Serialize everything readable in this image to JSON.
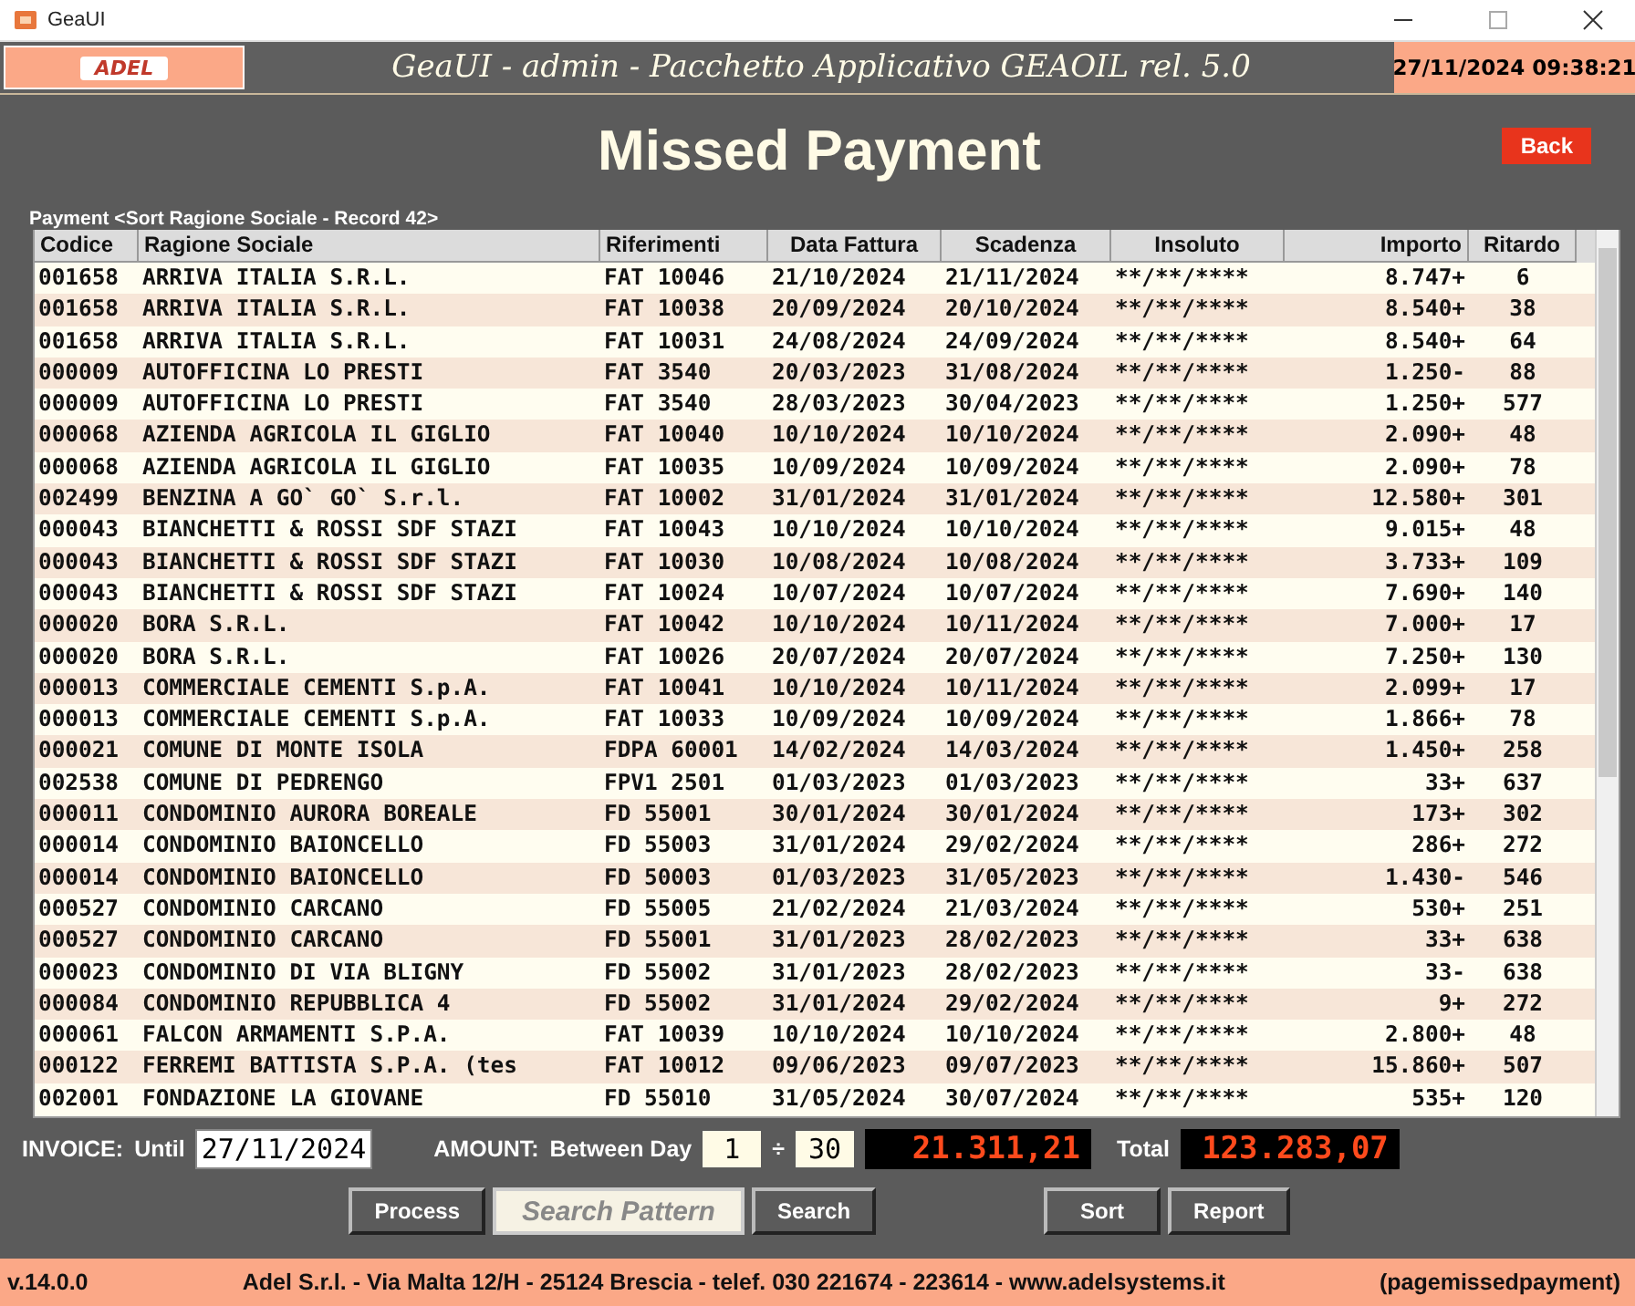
{
  "window": {
    "title": "GeaUI"
  },
  "header": {
    "logo": "ADEL",
    "title": "GeaUI - admin - Pacchetto Applicativo GEAOIL rel. 5.0",
    "datetime": "27/11/2024 09:38:21"
  },
  "page_title": "Missed Payment",
  "back_button": "Back",
  "table": {
    "caption": "Payment <Sort Ragione Sociale - Record 42>",
    "columns": [
      "Codice",
      "Ragione Sociale",
      "Riferimenti",
      "Data Fattura",
      "Scadenza",
      "Insoluto",
      "Importo",
      "Ritardo"
    ],
    "rows": [
      [
        "001658",
        "ARRIVA ITALIA S.R.L.",
        "FAT 10046",
        "21/10/2024",
        "21/11/2024",
        "**/**/****",
        "8.747+",
        "6"
      ],
      [
        "001658",
        "ARRIVA ITALIA S.R.L.",
        "FAT 10038",
        "20/09/2024",
        "20/10/2024",
        "**/**/****",
        "8.540+",
        "38"
      ],
      [
        "001658",
        "ARRIVA ITALIA S.R.L.",
        "FAT 10031",
        "24/08/2024",
        "24/09/2024",
        "**/**/****",
        "8.540+",
        "64"
      ],
      [
        "000009",
        "AUTOFFICINA LO PRESTI",
        "FAT 3540",
        "20/03/2023",
        "31/08/2024",
        "**/**/****",
        "1.250-",
        "88"
      ],
      [
        "000009",
        "AUTOFFICINA LO PRESTI",
        "FAT 3540",
        "28/03/2023",
        "30/04/2023",
        "**/**/****",
        "1.250+",
        "577"
      ],
      [
        "000068",
        "AZIENDA AGRICOLA IL GIGLIO",
        "FAT 10040",
        "10/10/2024",
        "10/10/2024",
        "**/**/****",
        "2.090+",
        "48"
      ],
      [
        "000068",
        "AZIENDA AGRICOLA IL GIGLIO",
        "FAT 10035",
        "10/09/2024",
        "10/09/2024",
        "**/**/****",
        "2.090+",
        "78"
      ],
      [
        "002499",
        "BENZINA A GO` GO` S.r.l.",
        "FAT 10002",
        "31/01/2024",
        "31/01/2024",
        "**/**/****",
        "12.580+",
        "301"
      ],
      [
        "000043",
        "BIANCHETTI & ROSSI SDF STAZI",
        "FAT 10043",
        "10/10/2024",
        "10/10/2024",
        "**/**/****",
        "9.015+",
        "48"
      ],
      [
        "000043",
        "BIANCHETTI & ROSSI SDF STAZI",
        "FAT 10030",
        "10/08/2024",
        "10/08/2024",
        "**/**/****",
        "3.733+",
        "109"
      ],
      [
        "000043",
        "BIANCHETTI & ROSSI SDF STAZI",
        "FAT 10024",
        "10/07/2024",
        "10/07/2024",
        "**/**/****",
        "7.690+",
        "140"
      ],
      [
        "000020",
        "BORA S.R.L.",
        "FAT 10042",
        "10/10/2024",
        "10/11/2024",
        "**/**/****",
        "7.000+",
        "17"
      ],
      [
        "000020",
        "BORA S.R.L.",
        "FAT 10026",
        "20/07/2024",
        "20/07/2024",
        "**/**/****",
        "7.250+",
        "130"
      ],
      [
        "000013",
        "COMMERCIALE CEMENTI S.p.A.",
        "FAT 10041",
        "10/10/2024",
        "10/11/2024",
        "**/**/****",
        "2.099+",
        "17"
      ],
      [
        "000013",
        "COMMERCIALE CEMENTI S.p.A.",
        "FAT 10033",
        "10/09/2024",
        "10/09/2024",
        "**/**/****",
        "1.866+",
        "78"
      ],
      [
        "000021",
        "COMUNE DI MONTE ISOLA",
        "FDPA 60001",
        "14/02/2024",
        "14/03/2024",
        "**/**/****",
        "1.450+",
        "258"
      ],
      [
        "002538",
        "COMUNE DI PEDRENGO",
        "FPV1 2501",
        "01/03/2023",
        "01/03/2023",
        "**/**/****",
        "33+",
        "637"
      ],
      [
        "000011",
        "CONDOMINIO AURORA BOREALE",
        "FD 55001",
        "30/01/2024",
        "30/01/2024",
        "**/**/****",
        "173+",
        "302"
      ],
      [
        "000014",
        "CONDOMINIO BAIONCELLO",
        "FD 55003",
        "31/01/2024",
        "29/02/2024",
        "**/**/****",
        "286+",
        "272"
      ],
      [
        "000014",
        "CONDOMINIO BAIONCELLO",
        "FD 50003",
        "01/03/2023",
        "31/05/2023",
        "**/**/****",
        "1.430-",
        "546"
      ],
      [
        "000527",
        "CONDOMINIO CARCANO",
        "FD 55005",
        "21/02/2024",
        "21/03/2024",
        "**/**/****",
        "530+",
        "251"
      ],
      [
        "000527",
        "CONDOMINIO CARCANO",
        "FD 55001",
        "31/01/2023",
        "28/02/2023",
        "**/**/****",
        "33+",
        "638"
      ],
      [
        "000023",
        "CONDOMINIO DI VIA BLIGNY",
        "FD 55002",
        "31/01/2023",
        "28/02/2023",
        "**/**/****",
        "33-",
        "638"
      ],
      [
        "000084",
        "CONDOMINIO REPUBBLICA 4",
        "FD 55002",
        "31/01/2024",
        "29/02/2024",
        "**/**/****",
        "9+",
        "272"
      ],
      [
        "000061",
        "FALCON ARMAMENTI S.P.A.",
        "FAT 10039",
        "10/10/2024",
        "10/10/2024",
        "**/**/****",
        "2.800+",
        "48"
      ],
      [
        "000122",
        "FERREMI BATTISTA S.P.A. (tes",
        "FAT 10012",
        "09/06/2023",
        "09/07/2023",
        "**/**/****",
        "15.860+",
        "507"
      ],
      [
        "002001",
        "FONDAZIONE LA GIOVANE",
        "FD 55010",
        "31/05/2024",
        "30/07/2024",
        "**/**/****",
        "535+",
        "120"
      ]
    ]
  },
  "filters": {
    "invoice_label": "INVOICE:",
    "until_label": "Until",
    "until_value": "27/11/2024",
    "amount_label": "AMOUNT:",
    "between_label": "Between Day",
    "day_from": "1",
    "separator": "÷",
    "day_to": "30",
    "amount_value": "21.311,21",
    "total_label": "Total",
    "total_value": "123.283,07"
  },
  "buttons": [
    {
      "kind": "button",
      "label": "Process"
    },
    {
      "kind": "field",
      "placeholder": "Search Pattern"
    },
    {
      "kind": "button",
      "label": "Search"
    },
    {
      "kind": "gap"
    },
    {
      "kind": "button",
      "label": "Sort"
    },
    {
      "kind": "button",
      "label": "Report"
    }
  ],
  "status_bar": {
    "version": "v.14.0.0",
    "company": "Adel S.r.l. - Via Malta 12/H - 25124 Brescia - telef. 030 221674 - 223614 - www.adelsystems.it",
    "page": "(pagemissedpayment)"
  }
}
